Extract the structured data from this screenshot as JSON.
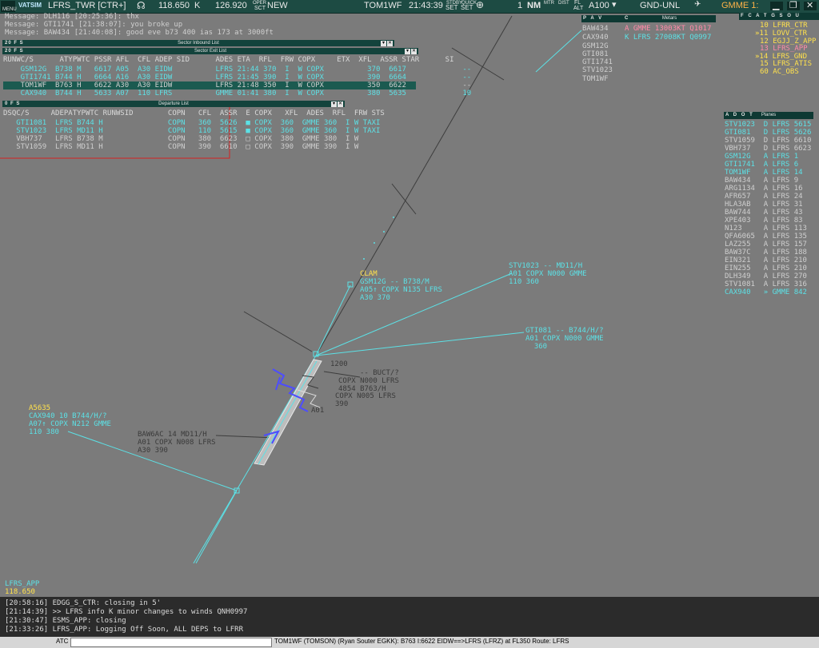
{
  "toolbar": {
    "menu": "MENU",
    "logo": "VATSIM",
    "callsign": "LFRS_TWR [CTR+]",
    "freq1": "118.650",
    "k": "K",
    "freq2": "126.920",
    "oper": "OPER",
    "sct": "SCT",
    "new": "NEW",
    "active_callsign": "TOM1WF",
    "time": "21:43:39",
    "set1": "SET",
    "set2": "SET",
    "num": "1",
    "nm": "NM",
    "fl": "FL",
    "alt": "ALT",
    "level": "A100",
    "filter": "GND-UNL",
    "gmme": "GMME 1:",
    "small_labels": [
      "STDBY",
      "QUICK",
      "SET",
      "SET"
    ]
  },
  "messages": [
    "Message: DLH116 [20:25:36]: thx",
    "Message: GTI1741 [21:38:07]: you broke up",
    "Message: BAW434 [21:40:08]: good eve b73 400 ias 173 at 3000ft"
  ],
  "sector_inbound": {
    "left": "20  F  S",
    "title": "Sector Inbound List"
  },
  "sector_exit": {
    "left": "20  F  S",
    "title": "Sector Exit List",
    "header": "RUNWC/S      ATYPWTC PSSR AFL  CFL ADEP SID      ADES ETA  RFL  FRW COPX     ETX  XFL  ASSR STAR      SI",
    "rows": [
      "    GSM12G  B738 M   6617 A05  A30 EIDW          LFRS 21:44 370  I  W COPX          370  6617             --",
      "    GTI1741 B744 H   6664 A16  A30 EIDW          LFRS 21:45 390  I  W COPX          390  6664             --",
      "    TOM1WF  B763 H   6622 A30  A30 EIDW          LFRS 21:48 350  I  W COPX          350  6622             --",
      "    CAX940  B744 H   5633 A07  110 LFRS          GMME 01:41 380  I  W COPX          380  5635             10"
    ]
  },
  "departure": {
    "left": "0  F  S",
    "title": "Departure List",
    "header": "DSQC/S     ADEPATYPWTC RUNWSID        COPN   CFL  ASSR  E COPX   XFL  ADES  RFL  FRW STS",
    "rows": [
      "   GTI1081  LFRS B744 H               COPN   360  5626  ■ COPX  360  GMME 360  I W TAXI",
      "   STV1023  LFRS MD11 H               COPN   110  5615  ■ COPX  360  GMME 360  I W TAXI",
      "   VBH737   LFRS B738 M               COPN   380  6623  □ COPX  380  GMME 380  I W",
      "   STV1059  LFRS MD11 H               COPN   390  6610  □ COPX  390  GMME 390  I W"
    ]
  },
  "pav_panel": {
    "left": "P A V",
    "list": [
      "BAW434",
      "CAX940",
      "GSM12G",
      "GTI081",
      "GTI1741",
      "STV1023",
      "TOM1WF"
    ]
  },
  "metars": {
    "left": "C",
    "title": "Metars",
    "lines": [
      "A GMME 13003KT Q1017",
      "K LFRS 27008KT Q0997"
    ]
  },
  "atc_panel": {
    "left": "F C A T G S O U",
    "lines": [
      "10 LFRR_CTR",
      "»11 LOVV_CTR",
      "12 EGJJ_Z_APP",
      "13 LFRS_APP",
      "»14 LFRS_GND",
      "15 LFRS_ATIS",
      "60 AC_OBS"
    ]
  },
  "planes": {
    "left": "A D O T",
    "title": "Planes",
    "rows": [
      "STV1023  D LFRS 5615",
      "GTI081   D LFRS 5626",
      "STV1059  D LFRS 6610",
      "VBH737   D LFRS 6623",
      "GSM12G   A LFRS 1",
      "GTI1741  A LFRS 6",
      "TOM1WF   A LFRS 14",
      "BAW434   A LFRS 9",
      "ARG1134  A LFRS 16",
      "AFR657   A LFRS 24",
      "HLA3AB   A LFRS 31",
      "BAW744   A LFRS 43",
      "XPE403   A LFRS 83",
      "N123     A LFRS 113",
      "QFA6065  A LFRS 135",
      "LAZ255   A LFRS 157",
      "BAW37C   A LFRS 188",
      "EIN321   A LFRS 210",
      "EIN255   A LFRS 210",
      "DLH349   A LFRS 270",
      "STV1081  A LFRS 316",
      "CAX940   » GMME 842"
    ]
  },
  "targets": {
    "gsm12g": [
      "CLAM",
      "GSM12G -- B738/M",
      "A05↑ COPX N135 LFRS",
      "A30 370"
    ],
    "stv1023": [
      "STV1023 -- MD11/H",
      "A01 COPX N000 GMME",
      "110 360"
    ],
    "gti081": [
      "GTI081 -- B744/H/?",
      "A01 COPX N000 GMME",
      "  360"
    ],
    "cax940": [
      "A5635",
      "CAX940 10 B744/H/?",
      "A07↑ COPX N212 GMME",
      "110 380"
    ],
    "baw6ac": [
      "BAW6AC 14 MD11/H",
      "A01 COPX N008 LFRS",
      "A30 390"
    ],
    "cluster": [
      "1200",
      "-- BUCT/?",
      "COPX N000 LFRS",
      "4854 B763/H",
      "COPX N005 LFRS",
      "390",
      "A01"
    ],
    "lfrs_app": [
      "LFRS_APP",
      "118.650"
    ]
  },
  "log": [
    "[20:58:16] EDGG_S_CTR: closing in 5'",
    "[21:14:39] >> LFRS info K minor changes to winds QNH0997",
    "[21:30:47] ESMS_APP: closing",
    "[21:33:26] LFRS_APP: Logging Off Soon, ALL DEPS to LFRR"
  ],
  "cmd": {
    "prefix": "ATC",
    "info": "TOM1WF (TOMSON) (Ryan Souter EGKK): B763 I:6622 EIDW==>LFRS (LFRZ) at FL350 Route: LFRS"
  }
}
